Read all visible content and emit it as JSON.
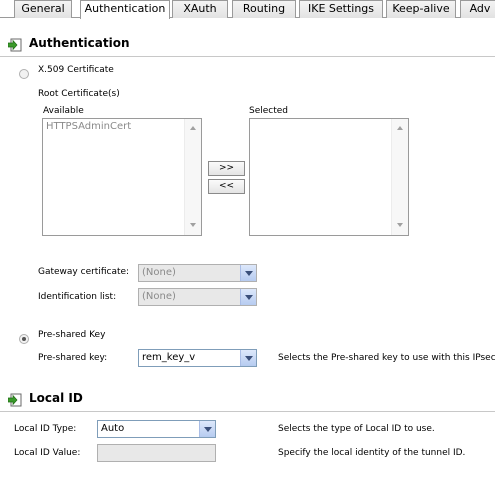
{
  "tabs": [
    "General",
    "Authentication",
    "XAuth",
    "Routing",
    "IKE Settings",
    "Keep-alive",
    "Adv"
  ],
  "authentication": {
    "title": "Authentication",
    "x509_label": "X.509 Certificate",
    "root_certs_label": "Root Certificate(s)",
    "available_label": "Available",
    "selected_label": "Selected",
    "available_items": [
      "HTTPSAdminCert"
    ],
    "add_button": ">>",
    "remove_button": "<<",
    "gateway_cert_label": "Gateway certificate:",
    "gateway_cert_value": "(None)",
    "ident_list_label": "Identification list:",
    "ident_list_value": "(None)",
    "psk_radio_label": "Pre-shared Key",
    "psk_field_label": "Pre-shared key:",
    "psk_value": "rem_key_v",
    "psk_help": "Selects the Pre-shared key to use with this IPsec Tu"
  },
  "local_id": {
    "title": "Local ID",
    "type_label": "Local ID Type:",
    "type_value": "Auto",
    "type_help": "Selects the type of Local ID to use.",
    "value_label": "Local ID Value:",
    "value_value": "",
    "value_help": "Specify the local identity of the tunnel ID."
  },
  "colors": {
    "section_icon_green": "#3a9a2a",
    "dropdown_blue": "#b6cbf0"
  },
  "icons": {
    "section": "arrow-into-box-icon"
  }
}
